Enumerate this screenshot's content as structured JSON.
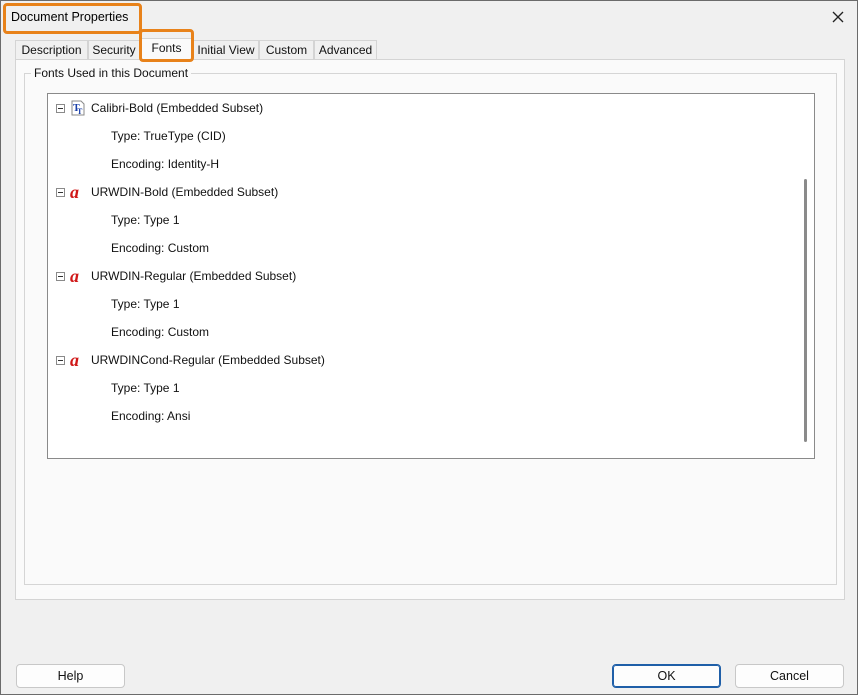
{
  "window": {
    "title": "Document Properties",
    "close_icon": "close-icon",
    "highlight_color": "#e8821a"
  },
  "tabs": [
    {
      "label": "Description",
      "active": false
    },
    {
      "label": "Security",
      "active": false
    },
    {
      "label": "Fonts",
      "active": true
    },
    {
      "label": "Initial View",
      "active": false
    },
    {
      "label": "Custom",
      "active": false
    },
    {
      "label": "Advanced",
      "active": false
    }
  ],
  "fonts_panel": {
    "group_label": "Fonts Used in this Document",
    "fonts": [
      {
        "name": "Calibri-Bold (Embedded Subset)",
        "icon": "truetype-font-icon",
        "type": "Type: TrueType (CID)",
        "encoding": "Encoding: Identity-H"
      },
      {
        "name": "URWDIN-Bold (Embedded Subset)",
        "icon": "type1-font-icon",
        "type": "Type: Type 1",
        "encoding": "Encoding: Custom"
      },
      {
        "name": "URWDIN-Regular (Embedded Subset)",
        "icon": "type1-font-icon",
        "type": "Type: Type 1",
        "encoding": "Encoding: Custom"
      },
      {
        "name": "URWDINCond-Regular (Embedded Subset)",
        "icon": "type1-font-icon",
        "type": "Type: Type 1",
        "encoding": "Encoding: Ansi"
      }
    ]
  },
  "buttons": {
    "help": "Help",
    "ok": "OK",
    "cancel": "Cancel"
  }
}
